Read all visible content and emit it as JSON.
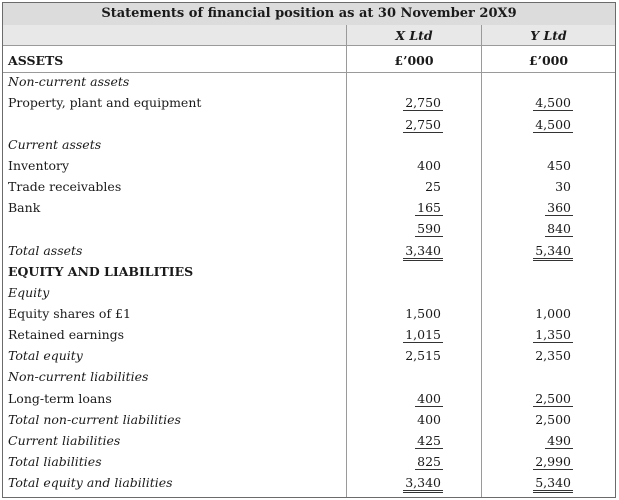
{
  "title": "Statements of financial position as at 30 November 20X9",
  "columns": {
    "x_name": "X Ltd",
    "y_name": "Y Ltd",
    "x_unit": "£’000",
    "y_unit": "£’000"
  },
  "assets_heading": "ASSETS",
  "rows": {
    "nca_heading": "Non-current assets",
    "ppe": {
      "label": "Property, plant and equipment",
      "x": "2,750",
      "y": "4,500"
    },
    "nca_total": {
      "x": "2,750",
      "y": "4,500"
    },
    "ca_heading": "Current assets",
    "inventory": {
      "label": "Inventory",
      "x": "400",
      "y": "450"
    },
    "receivables": {
      "label": "Trade receivables",
      "x": "25",
      "y": "30"
    },
    "bank": {
      "label": "Bank",
      "x": "165",
      "y": "360"
    },
    "ca_total": {
      "x": "590",
      "y": "840"
    },
    "total_assets": {
      "label": "Total assets",
      "x": "3,340",
      "y": "5,340"
    },
    "eq_liab_heading": "EQUITY AND LIABILITIES",
    "equity_heading": "Equity",
    "shares": {
      "label": "Equity shares of £1",
      "x": "1,500",
      "y": "1,000"
    },
    "retained": {
      "label": "Retained earnings",
      "x": "1,015",
      "y": "1,350"
    },
    "total_equity": {
      "label": "Total equity",
      "x": "2,515",
      "y": "2,350"
    },
    "ncl_heading": "Non-current liabilities",
    "loans": {
      "label": "Long-term loans",
      "x": "400",
      "y": "2,500"
    },
    "total_ncl": {
      "label": "Total non-current liabilities",
      "x": "400",
      "y": "2,500"
    },
    "cl": {
      "label": "Current liabilities",
      "x": "425",
      "y": "490"
    },
    "total_liab": {
      "label": "Total liabilities",
      "x": "825",
      "y": "2,990"
    },
    "total_eq_liab": {
      "label": "Total equity and liabilities",
      "x": "3,340",
      "y": "5,340"
    }
  }
}
